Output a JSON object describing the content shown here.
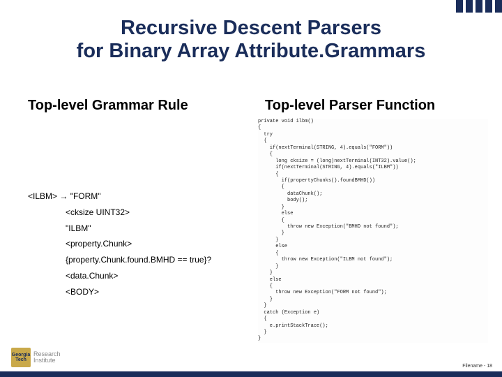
{
  "title_line1": "Recursive Descent Parsers",
  "title_line2": "for Binary Array Attribute.Grammars",
  "section_left": "Top-level Grammar Rule",
  "section_right": "Top-level Parser Function",
  "grammar": {
    "l1": "<ILBM> → \"FORM\"",
    "l2": "<cksize UINT32>",
    "l3": "\"ILBM\"",
    "l4": "<property.Chunk>",
    "l5": "{property.Chunk.found.BMHD == true}?",
    "l6": "<data.Chunk>",
    "l7": "<BODY>"
  },
  "code": "private void ilbm()\n{\n  try\n  {\n    if(nextTerminal(STRING, 4).equals(\"FORM\"))\n    {\n      long cksize = (long)nextTerminal(INT32).value();\n      if(nextTerminal(STRING, 4).equals(\"ILBM\"))\n      {\n        if(propertyChunks().foundBMHD())\n        {\n          dataChunk();\n          body();\n        }\n        else\n        {\n          throw new Exception(\"BMHD not found\");\n        }\n      }\n      else\n      {\n        throw new Exception(\"ILBM not found\");\n      }\n    }\n    else\n    {\n      throw new Exception(\"FORM not found\");\n    }\n  }\n  catch (Exception e)\n  {\n    e.printStackTrace();\n  }\n}",
  "logo": {
    "l1": "Georgia",
    "l2": "Tech",
    "inst": "Research\nInstitute"
  },
  "footer": "Filename - 18"
}
